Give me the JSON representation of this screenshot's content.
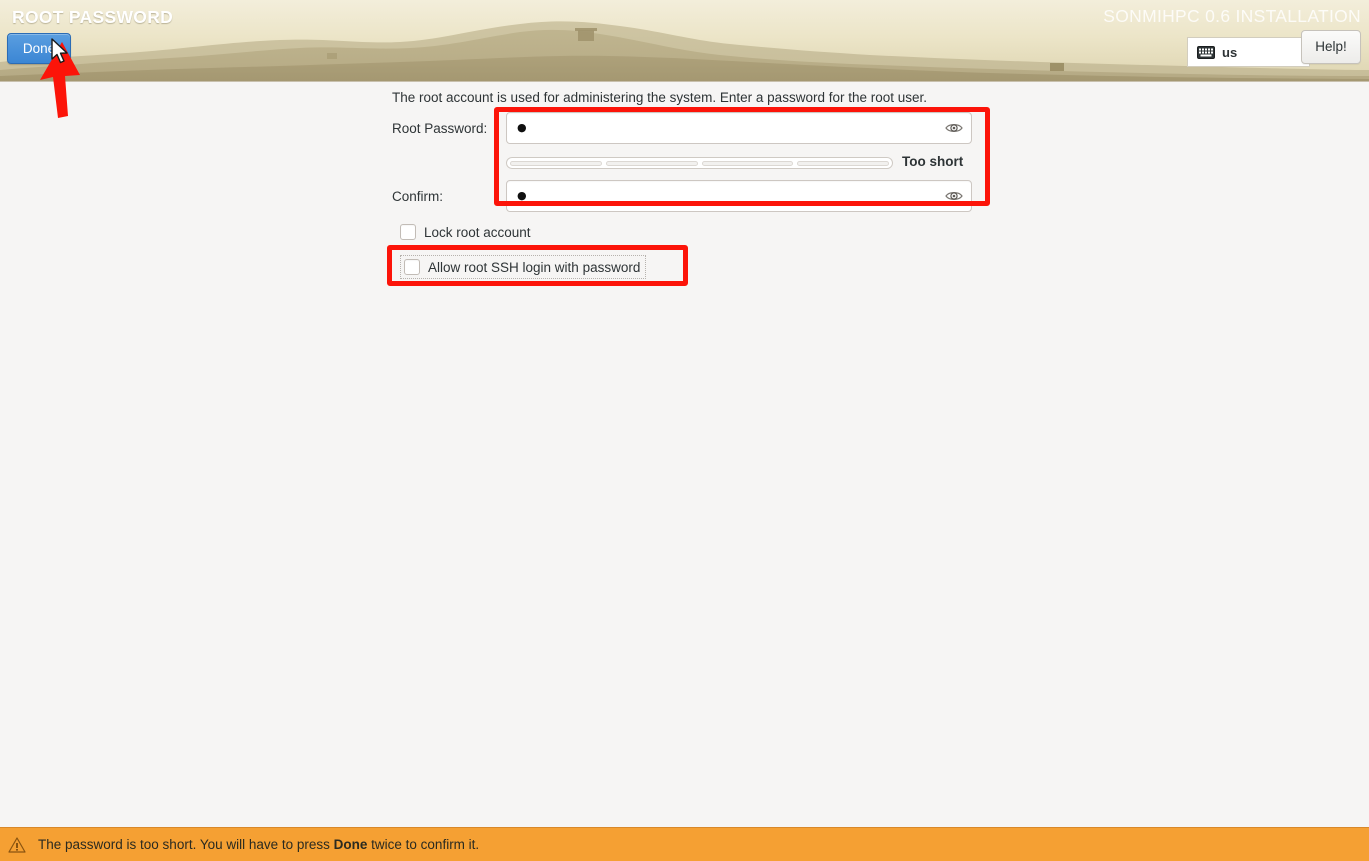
{
  "header": {
    "title": "ROOT PASSWORD",
    "product": "SONMIHPC 0.6 INSTALLATION",
    "done_label": "Done",
    "help_label": "Help!",
    "keyboard_layout": "us",
    "keyboard_icon": "keyboard-icon",
    "accent_color": "#3b86d4"
  },
  "main": {
    "intro": "The root account is used for administering the system.  Enter a password for the root user.",
    "root_password": {
      "label": "Root Password:",
      "value": "●",
      "masked": true,
      "reveal_icon": "eye-icon"
    },
    "confirm_password": {
      "label": "Confirm:",
      "value": "●",
      "masked": true,
      "reveal_icon": "eye-icon"
    },
    "strength": {
      "text": "Too short",
      "segments": 4,
      "filled": 0
    },
    "options": [
      {
        "id": "lock-root-account",
        "label": "Lock root account",
        "checked": false,
        "focused": false
      },
      {
        "id": "allow-root-ssh",
        "label": "Allow root SSH login with password",
        "checked": false,
        "focused": true
      }
    ]
  },
  "status": {
    "icon": "warning-triangle-icon",
    "message_prefix": "The password is too short. You will have to press ",
    "message_bold": "Done",
    "message_suffix": " twice to confirm it.",
    "bar_color": "#f5a033"
  },
  "annotations": {
    "color": "#fc1409",
    "boxes": [
      "password-fields-highlight",
      "allow-root-ssh-highlight"
    ],
    "arrow": "done-button-arrow"
  }
}
